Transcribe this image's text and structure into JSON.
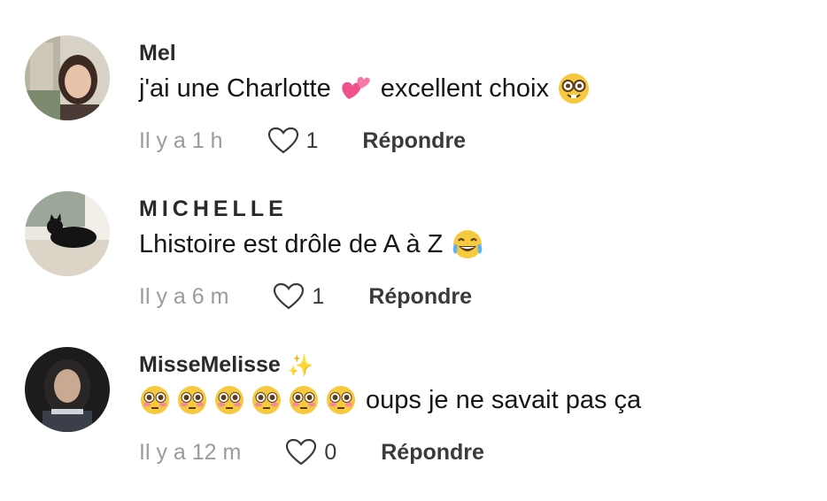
{
  "comments": [
    {
      "username": "Mel",
      "text": "j'ai une Charlotte",
      "text_after": "excellent choix",
      "time": "Il y a 1 h",
      "likes": "1",
      "reply_label": "Répondre",
      "emojis": [
        "two-hearts",
        "nerd-face"
      ]
    },
    {
      "username": "MICHELLE",
      "text": "Lhistoire est drôle de A à Z",
      "time": "Il y a 6 m",
      "likes": "1",
      "reply_label": "Répondre",
      "emojis": [
        "tears-of-joy"
      ]
    },
    {
      "username": "MisseMelisse",
      "username_emoji": "sparkles",
      "text": "oups je ne savait pas ça",
      "time": "Il y a 12 m",
      "likes": "0",
      "reply_label": "Répondre",
      "emojis": [
        "flushed-face",
        "flushed-face",
        "flushed-face",
        "flushed-face",
        "flushed-face",
        "flushed-face"
      ]
    }
  ],
  "colors": {
    "username": "#2a2a2a",
    "text": "#161616",
    "muted": "#9b9b9b",
    "action": "#3a3a3a",
    "emoji_yellow": "#f7c93e",
    "heart_pink": "#f0508c"
  }
}
